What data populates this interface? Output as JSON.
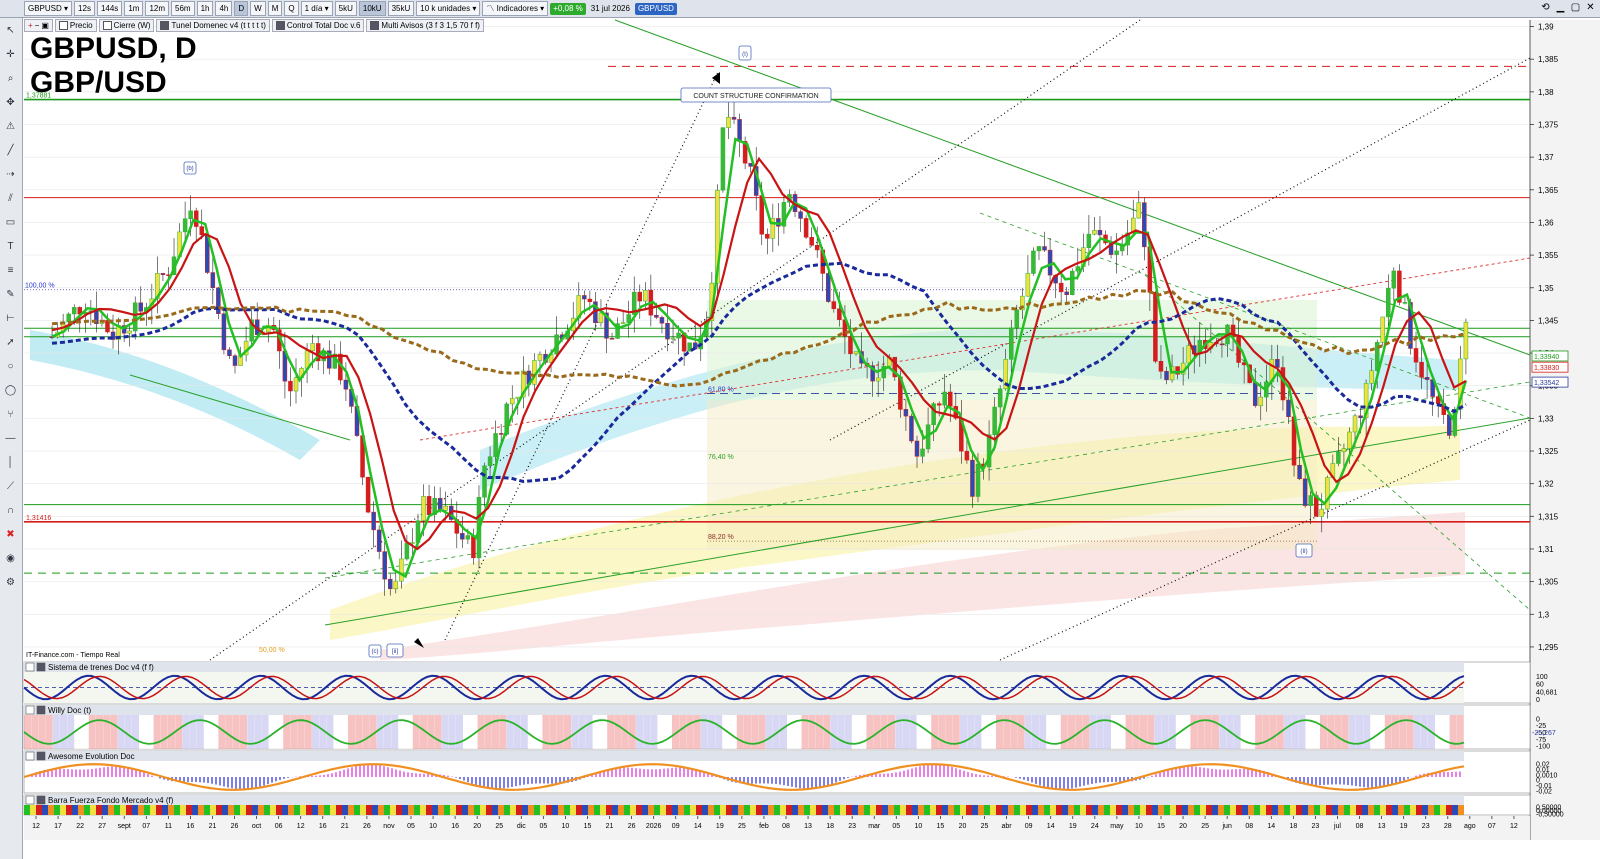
{
  "toolbar": {
    "symbol": "GBPUSD",
    "intervals": [
      "12s",
      "144s",
      "1m",
      "12m",
      "56m",
      "1h",
      "4h",
      "D",
      "W",
      "M",
      "Q"
    ],
    "active_interval": "D",
    "period": "1 día",
    "units": [
      "5kU",
      "10kU",
      "35kU"
    ],
    "active_unit": "10kU",
    "units_label": "10 k unidades",
    "indicators_label": "Indicadores",
    "change": "+0,08 %",
    "date": "31 jul 2026",
    "ticker_badge": "GBP/USD",
    "colors": {
      "change_bg": "#2eab2e",
      "ticker_bg": "#2c64c4"
    }
  },
  "indicators_bar": [
    {
      "label": "Precio",
      "checked": false
    },
    {
      "label": "Cierre (W)",
      "checked": false
    },
    {
      "label": "Tunel Domenec v4 (t t t t t)",
      "checked": true
    },
    {
      "label": "Control Total Doc v.6",
      "checked": true
    },
    {
      "label": "Multi Avisos (3 f 3 1,5 70 f f)",
      "checked": true
    }
  ],
  "title": {
    "line1": "GBPUSD, D",
    "line2": "GBP/USD"
  },
  "source_label": "IT-Finance.com - Tiempo Real",
  "chart_data": [
    {
      "type": "candlestick",
      "panel": "price",
      "title": "GBPUSD, D",
      "subtitle": "GBP/USD",
      "ylim": [
        1.293,
        1.391
      ],
      "y_ticks": [
        "1,295",
        "1,3",
        "1,305",
        "1,31",
        "1,315",
        "1,32",
        "1,325",
        "1,33",
        "1,335",
        "1,34",
        "1,345",
        "1,35",
        "1,355",
        "1,36",
        "1,365",
        "1,37",
        "1,375",
        "1,38",
        "1,385",
        "1,39"
      ],
      "x_ticks": [
        "12",
        "17",
        "22",
        "27",
        "sept",
        "07",
        "11",
        "16",
        "21",
        "26",
        "oct",
        "06",
        "12",
        "16",
        "21",
        "26",
        "nov",
        "05",
        "10",
        "16",
        "20",
        "25",
        "dic",
        "05",
        "10",
        "15",
        "21",
        "26",
        "2026",
        "09",
        "14",
        "19",
        "25",
        "feb",
        "08",
        "13",
        "18",
        "23",
        "mar",
        "05",
        "10",
        "15",
        "20",
        "25",
        "abr",
        "09",
        "14",
        "19",
        "24",
        "may",
        "10",
        "15",
        "20",
        "25",
        "jun",
        "08",
        "14",
        "18",
        "23",
        "jul",
        "08",
        "13",
        "19",
        "23",
        "28",
        "ago",
        "07",
        "12"
      ],
      "price_close_path": [
        [
          "2025-08-12",
          1.3425
        ],
        [
          "2025-08-20",
          1.348
        ],
        [
          "2025-08-27",
          1.343
        ],
        [
          "2025-09-03",
          1.3465
        ],
        [
          "2025-09-10",
          1.353
        ],
        [
          "2025-09-16",
          1.364
        ],
        [
          "2025-09-22",
          1.3475
        ],
        [
          "2025-09-26",
          1.3365
        ],
        [
          "2025-10-01",
          1.3445
        ],
        [
          "2025-10-06",
          1.3445
        ],
        [
          "2025-10-10",
          1.3335
        ],
        [
          "2025-10-16",
          1.3415
        ],
        [
          "2025-10-24",
          1.3365
        ],
        [
          "2025-10-30",
          1.316
        ],
        [
          "2025-11-05",
          1.3025
        ],
        [
          "2025-11-12",
          1.3165
        ],
        [
          "2025-11-18",
          1.3155
        ],
        [
          "2025-11-25",
          1.3095
        ],
        [
          "2025-11-28",
          1.323
        ],
        [
          "2025-12-04",
          1.3325
        ],
        [
          "2025-12-10",
          1.338
        ],
        [
          "2025-12-17",
          1.3435
        ],
        [
          "2025-12-23",
          1.3485
        ],
        [
          "2025-12-30",
          1.3425
        ],
        [
          "2026-01-06",
          1.349
        ],
        [
          "2026-01-12",
          1.3445
        ],
        [
          "2026-01-19",
          1.3405
        ],
        [
          "2026-01-23",
          1.347
        ],
        [
          "2026-01-27",
          1.3775
        ],
        [
          "2026-02-02",
          1.368
        ],
        [
          "2026-02-06",
          1.3565
        ],
        [
          "2026-02-12",
          1.365
        ],
        [
          "2026-02-17",
          1.3585
        ],
        [
          "2026-02-23",
          1.3465
        ],
        [
          "2026-03-02",
          1.3365
        ],
        [
          "2026-03-09",
          1.3385
        ],
        [
          "2026-03-16",
          1.3245
        ],
        [
          "2026-03-23",
          1.3345
        ],
        [
          "2026-03-30",
          1.3195
        ],
        [
          "2026-04-03",
          1.3265
        ],
        [
          "2026-04-10",
          1.3465
        ],
        [
          "2026-04-15",
          1.3555
        ],
        [
          "2026-04-22",
          1.3495
        ],
        [
          "2026-04-28",
          1.3585
        ],
        [
          "2026-05-05",
          1.3555
        ],
        [
          "2026-05-11",
          1.3625
        ],
        [
          "2026-05-15",
          1.3355
        ],
        [
          "2026-05-19",
          1.3365
        ],
        [
          "2026-05-26",
          1.3425
        ],
        [
          "2026-06-01",
          1.3435
        ],
        [
          "2026-06-08",
          1.3325
        ],
        [
          "2026-06-14",
          1.3395
        ],
        [
          "2026-06-19",
          1.3195
        ],
        [
          "2026-06-24",
          1.3155
        ],
        [
          "2026-06-30",
          1.3245
        ],
        [
          "2026-07-06",
          1.3335
        ],
        [
          "2026-07-13",
          1.3535
        ],
        [
          "2026-07-17",
          1.3425
        ],
        [
          "2026-07-24",
          1.3305
        ],
        [
          "2026-07-28",
          1.3285
        ],
        [
          "2026-07-31",
          1.3462
        ]
      ],
      "horizontal_levels": [
        {
          "price": 1.37881,
          "label": "1,37881",
          "color": "#1a9a1a",
          "style": "solid"
        },
        {
          "price": 1.31416,
          "label": "1,31416",
          "color": "#d81c1c",
          "style": "solid"
        },
        {
          "price": 1.3839,
          "label": "",
          "color": "#d81c1c",
          "style": "dashed"
        },
        {
          "price": 1.3638,
          "label": "",
          "color": "#d81c1c",
          "style": "solid"
        },
        {
          "price": 1.3438,
          "label": "",
          "color": "#1a9a1a",
          "style": "solid"
        },
        {
          "price": 1.3425,
          "label": "",
          "color": "#1a9a1a",
          "style": "solid"
        },
        {
          "price": 1.3168,
          "label": "",
          "color": "#1a9a1a",
          "style": "solid"
        },
        {
          "price": 1.3063,
          "label": "",
          "color": "#1a9a1a",
          "style": "dashed"
        }
      ],
      "fib_levels": [
        {
          "label": "100,00 %",
          "price": 1.3497
        },
        {
          "label": "61,80 %",
          "price": 1.3338
        },
        {
          "label": "76,40 %",
          "price": 1.3235
        },
        {
          "label": "88,20 %",
          "price": 1.3112
        },
        {
          "label": "50,00 %",
          "price": 1.2945
        }
      ],
      "price_tags": [
        {
          "label": "1,33940",
          "price": 1.3394,
          "color": "#1a9a1a"
        },
        {
          "label": "1,33830",
          "price": 1.3383,
          "color": "#d81c1c"
        },
        {
          "label": "1,33542",
          "price": 1.3354,
          "color": "#2a3a9a"
        }
      ],
      "annotations": [
        {
          "text": "COUNT STRUCTURE CONFIRMATION",
          "kind": "box"
        },
        {
          "text": "(I)",
          "kind": "wave"
        },
        {
          "text": "(b)",
          "kind": "wave"
        },
        {
          "text": "(c)",
          "kind": "wave"
        },
        {
          "text": "[ii]",
          "kind": "wave"
        },
        {
          "text": "(II)",
          "kind": "wave"
        }
      ]
    },
    {
      "type": "oscillator",
      "panel": "sub1",
      "title": "Sistema de trenes Doc v4 (f f)",
      "y_ticks": [
        "100",
        "60",
        "40,681",
        "0"
      ]
    },
    {
      "type": "oscillator",
      "panel": "sub2",
      "title": "Willy Doc (t)",
      "y_ticks": [
        "0",
        "-25",
        "-50",
        "-75",
        "-100"
      ],
      "value_tag": "-25,267"
    },
    {
      "type": "histogram",
      "panel": "sub3",
      "title": "Awesome Evolution Doc",
      "y_ticks": [
        "0,02",
        "0,01",
        "0,0010",
        "0",
        "-0,01",
        "-0,02"
      ]
    },
    {
      "type": "bars",
      "panel": "sub4",
      "title": "Barra Fuerza Fondo Mercado v4 (f)",
      "y_ticks": [
        "0,50000",
        "0,00000",
        "-0,50000"
      ]
    }
  ]
}
